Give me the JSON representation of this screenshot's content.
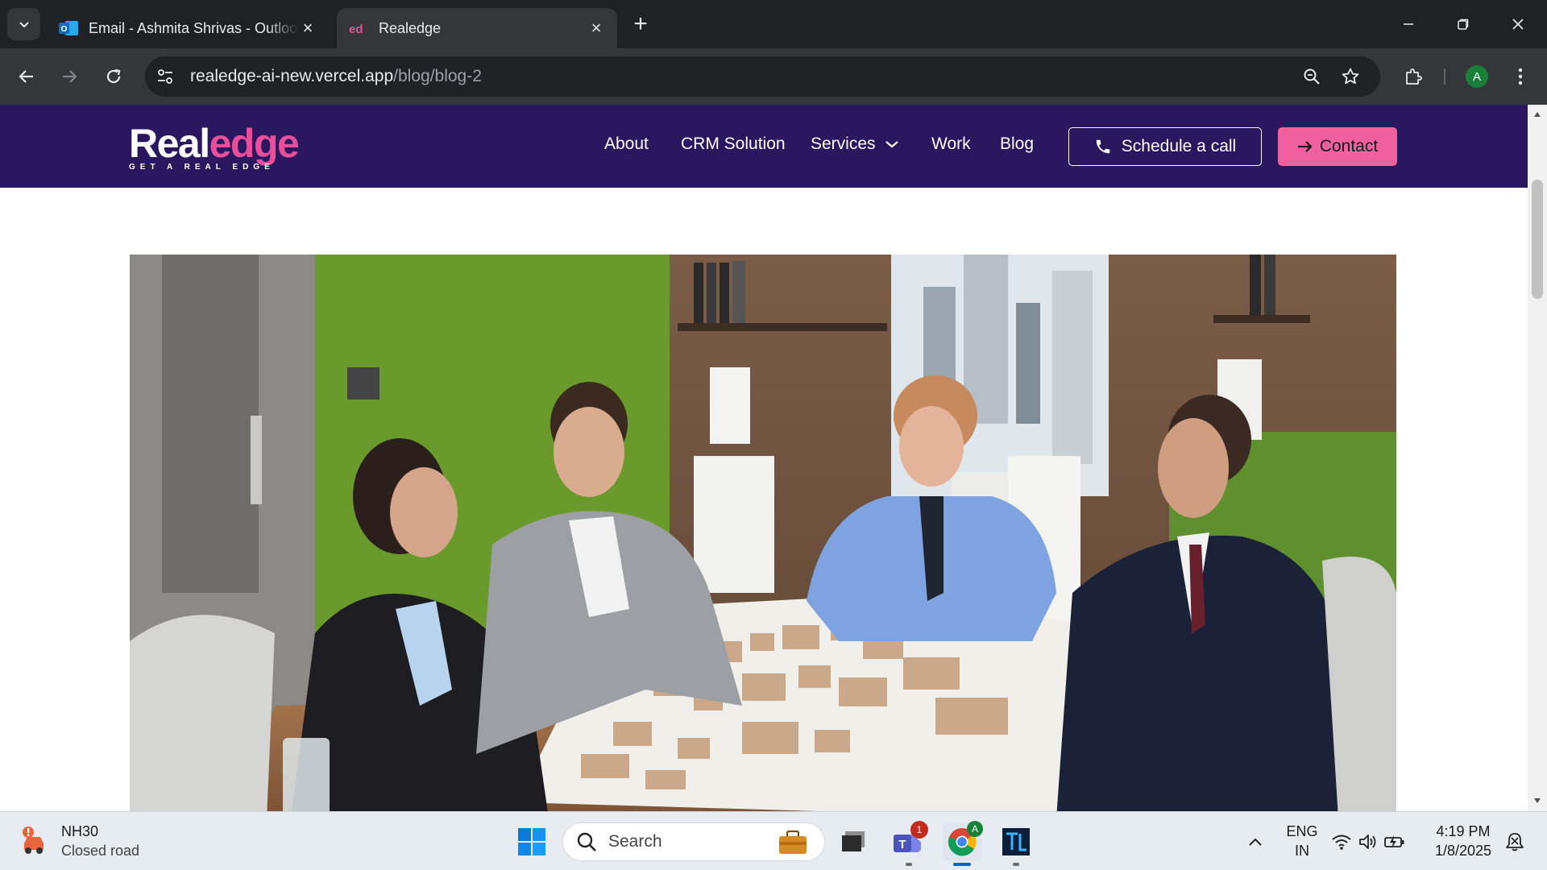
{
  "browser": {
    "tabs": [
      {
        "title": "Email - Ashmita Shrivas - Outlook",
        "active": false
      },
      {
        "title": "Realedge",
        "active": true
      }
    ],
    "address": {
      "domain": "realedge-ai-new.vercel.app",
      "path": "/blog/blog-2"
    },
    "profile_initial": "A"
  },
  "site": {
    "logo": {
      "word_start": "Real",
      "word_accent": "edge",
      "tagline": "GET A REAL EDGE"
    },
    "nav": {
      "about": "About",
      "crm": "CRM Solution",
      "services": "Services",
      "work": "Work",
      "blog": "Blog"
    },
    "cta": {
      "schedule": "Schedule a call",
      "contact": "Contact"
    },
    "colors": {
      "header_bg": "#2b1660",
      "accent_pink": "#f0609e"
    }
  },
  "taskbar": {
    "weather": {
      "title": "NH30",
      "subtitle": "Closed road"
    },
    "search_placeholder": "Search",
    "teams_badge": "1",
    "chrome_badge": "A",
    "lang": {
      "line1": "ENG",
      "line2": "IN"
    },
    "clock": {
      "time": "4:19 PM",
      "date": "1/8/2025"
    }
  }
}
